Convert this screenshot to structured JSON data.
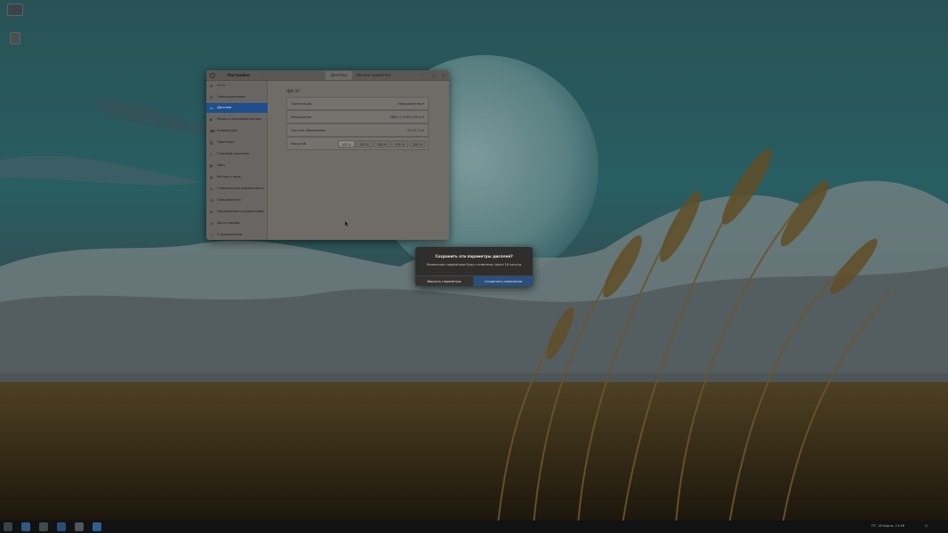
{
  "desktop": {
    "icons": [
      {
        "name": "home-folder"
      },
      {
        "name": "trash"
      }
    ]
  },
  "window": {
    "sidebar_title": "Настройки",
    "tabs": [
      {
        "label": "Дисплеи",
        "active": true
      },
      {
        "label": "Ночная подсветка",
        "active": false
      }
    ],
    "sidebar_items": [
      {
        "icon": "network-icon",
        "label": "Сеть",
        "selected": false
      },
      {
        "icon": "power-icon",
        "label": "Электропитание",
        "selected": false
      },
      {
        "icon": "display-icon",
        "label": "Дисплеи",
        "selected": true
      },
      {
        "icon": "mouse-icon",
        "label": "Мышь и сенсорная панель",
        "selected": false
      },
      {
        "icon": "keyboard-icon",
        "label": "Клавиатура",
        "selected": false
      },
      {
        "icon": "printer-icon",
        "label": "Принтеры",
        "selected": false
      },
      {
        "icon": "usb-drive-icon",
        "label": "Съёмный носитель",
        "selected": false
      },
      {
        "icon": "color-icon",
        "label": "Цвет",
        "selected": false
      },
      {
        "icon": "globe-icon",
        "label": "Регион и язык",
        "selected": false
      },
      {
        "icon": "accessibility-icon",
        "label": "Специальные возможности",
        "selected": false
      },
      {
        "icon": "users-icon",
        "label": "Пользователи",
        "selected": false
      },
      {
        "icon": "star-icon",
        "label": "Приложения по умолчанию",
        "selected": false
      },
      {
        "icon": "clock-icon",
        "label": "Дата и время",
        "selected": false
      },
      {
        "icon": "info-icon",
        "label": "О приложении",
        "selected": false
      }
    ],
    "monitor_name": "HJW 32\"",
    "rows": {
      "orientation": {
        "label": "Ориентация",
        "value": "Ландшафтная"
      },
      "resolution": {
        "label": "Разрешение",
        "value": "3840 × 2160 (16:9)"
      },
      "refresh": {
        "label": "Частота обновления",
        "value": "29.97 Гц"
      },
      "scale": {
        "label": "Масштаб"
      }
    },
    "scale_options": [
      {
        "label": "100 %",
        "selected": true
      },
      {
        "label": "125 %",
        "selected": false
      },
      {
        "label": "150 %",
        "selected": false
      },
      {
        "label": "175 %",
        "selected": false
      },
      {
        "label": "200 %",
        "selected": false
      }
    ]
  },
  "dialog": {
    "title": "Сохранить эти параметры дисплея?",
    "message": "Изменения параметров будут отменены через 16 секунд",
    "revert_label": "Вернуть параметры",
    "keep_label": "Сохранить изменения"
  },
  "taskbar": {
    "tray_text": "ПТ, 16 марта, 13:46",
    "apps": [
      {
        "name": "activities-icon"
      },
      {
        "name": "files-icon"
      },
      {
        "name": "terminal-icon"
      },
      {
        "name": "browser-icon"
      },
      {
        "name": "settings-icon"
      }
    ]
  },
  "colors": {
    "selection": "#1e4e8c",
    "dialog_keep": "#2a4e7e"
  }
}
